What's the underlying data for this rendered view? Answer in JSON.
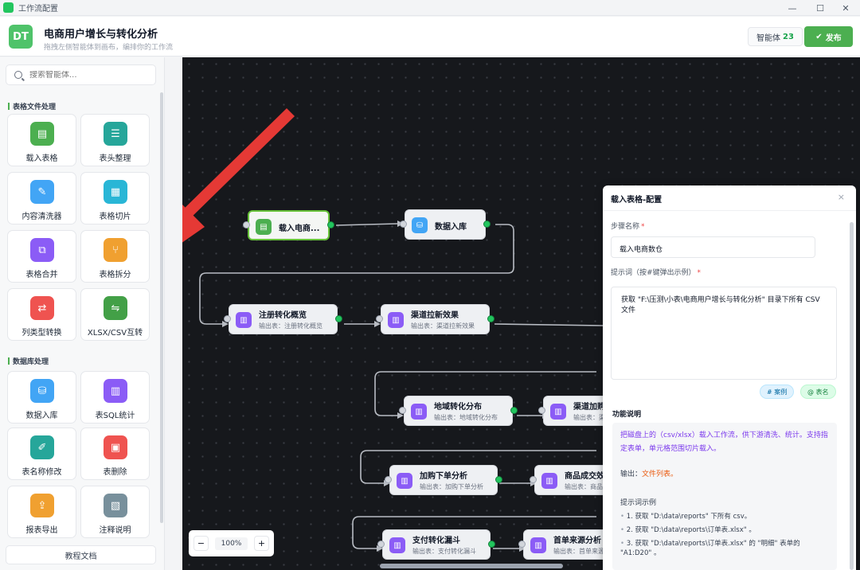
{
  "window": {
    "title": "工作流配置"
  },
  "header": {
    "logo": "DT",
    "title": "电商用户增长与转化分析",
    "subtitle": "拖拽左侧智能体到画布，编排你的工作流",
    "agent_label": "智能体",
    "agent_count": "23",
    "publish": "发布"
  },
  "sidebar": {
    "search_placeholder": "搜索智能体...",
    "sections": [
      {
        "title": "表格文件处理"
      },
      {
        "title": "数据库处理"
      }
    ],
    "tools": [
      {
        "label": "载入表格",
        "icon": "file-icon",
        "color": "#4caf50"
      },
      {
        "label": "表头整理",
        "icon": "table-header-icon",
        "color": "#26a69a"
      },
      {
        "label": "内容清洗器",
        "icon": "brush-icon",
        "color": "#42a5f5"
      },
      {
        "label": "表格切片",
        "icon": "grid-icon",
        "color": "#29b6d6"
      },
      {
        "label": "表格合并",
        "icon": "merge-icon",
        "color": "#8b5cf6"
      },
      {
        "label": "表格拆分",
        "icon": "split-icon",
        "color": "#f0a030"
      },
      {
        "label": "列类型转换",
        "icon": "convert-icon",
        "color": "#ef5350"
      },
      {
        "label": "XLSX/CSV互转",
        "icon": "swap-icon",
        "color": "#43a047"
      },
      {
        "label": "数据入库",
        "icon": "database-icon",
        "color": "#42a5f5"
      },
      {
        "label": "表SQL统计",
        "icon": "chart-icon",
        "color": "#8b5cf6"
      },
      {
        "label": "表名称修改",
        "icon": "edit-table-icon",
        "color": "#26a69a"
      },
      {
        "label": "表删除",
        "icon": "delete-table-icon",
        "color": "#ef5350"
      },
      {
        "label": "报表导出",
        "icon": "export-icon",
        "color": "#f0a030"
      },
      {
        "label": "注释说明",
        "icon": "note-icon",
        "color": "#78909c"
      }
    ],
    "docs_button": "教程文档"
  },
  "canvas": {
    "zoom": "100%",
    "zoom_out": "−",
    "zoom_in": "+",
    "nodes": [
      {
        "id": "n1",
        "title": "载入电商...",
        "subtitle": "",
        "icon": "file-icon",
        "color": "#4caf50"
      },
      {
        "id": "n2",
        "title": "数据入库",
        "subtitle": "",
        "icon": "database-icon",
        "color": "#42a5f5"
      },
      {
        "id": "n3",
        "title": "注册转化概览",
        "subtitle": "输出表：注册转化概览",
        "icon": "chart-icon",
        "color": "#8b5cf6"
      },
      {
        "id": "n4",
        "title": "渠道拉新效果",
        "subtitle": "输出表：渠道拉新效果",
        "icon": "chart-icon",
        "color": "#8b5cf6"
      },
      {
        "id": "n5",
        "title": "地域转化分布",
        "subtitle": "输出表：地域转化分布",
        "icon": "chart-icon",
        "color": "#8b5cf6"
      },
      {
        "id": "n6",
        "title": "渠道加购",
        "subtitle": "输出表：渠",
        "icon": "chart-icon",
        "color": "#8b5cf6"
      },
      {
        "id": "n7",
        "title": "加购下单分析",
        "subtitle": "输出表：加购下单分析",
        "icon": "chart-icon",
        "color": "#8b5cf6"
      },
      {
        "id": "n8",
        "title": "商品成交效",
        "subtitle": "输出表：商品",
        "icon": "chart-icon",
        "color": "#8b5cf6"
      },
      {
        "id": "n9",
        "title": "支付转化漏斗",
        "subtitle": "输出表：支付转化漏斗",
        "icon": "chart-icon",
        "color": "#8b5cf6"
      },
      {
        "id": "n10",
        "title": "首单来源分析",
        "subtitle": "输出表：首单来源",
        "icon": "chart-icon",
        "color": "#8b5cf6"
      }
    ]
  },
  "panel": {
    "title": "载入表格-配置",
    "close": "×",
    "step_name_label": "步骤名称",
    "step_name_value": "载入电商数仓",
    "prompt_label": "提示词（按#键弹出示例）",
    "prompt_value": "获取 \"F:\\压测\\小表\\电商用户增长与转化分析\" 目录下所有 CSV 文件",
    "chip_case": "# 案例",
    "chip_table": "@ 表名",
    "func_title": "功能说明",
    "func_desc": "把磁盘上的（csv/xlsx）载入工作流，供下游清洗、统计。支持指定表单，单元格范围切片载入。",
    "output_label": "输出：",
    "output_value": "文件列表。",
    "examples_title": "提示词示例",
    "examples": [
      "1. 获取 \"D:\\data\\reports\" 下所有 csv。",
      "2. 获取 \"D:\\data\\reports\\订单表.xlsx\" 。",
      "3. 获取 \"D:\\data\\reports\\订单表.xlsx\" 的 \"明细\" 表单的 \"A1:D20\" 。"
    ]
  },
  "colors": {
    "accent": "#4caf50",
    "canvas_bg": "#16181c",
    "arrow": "#e53935"
  }
}
